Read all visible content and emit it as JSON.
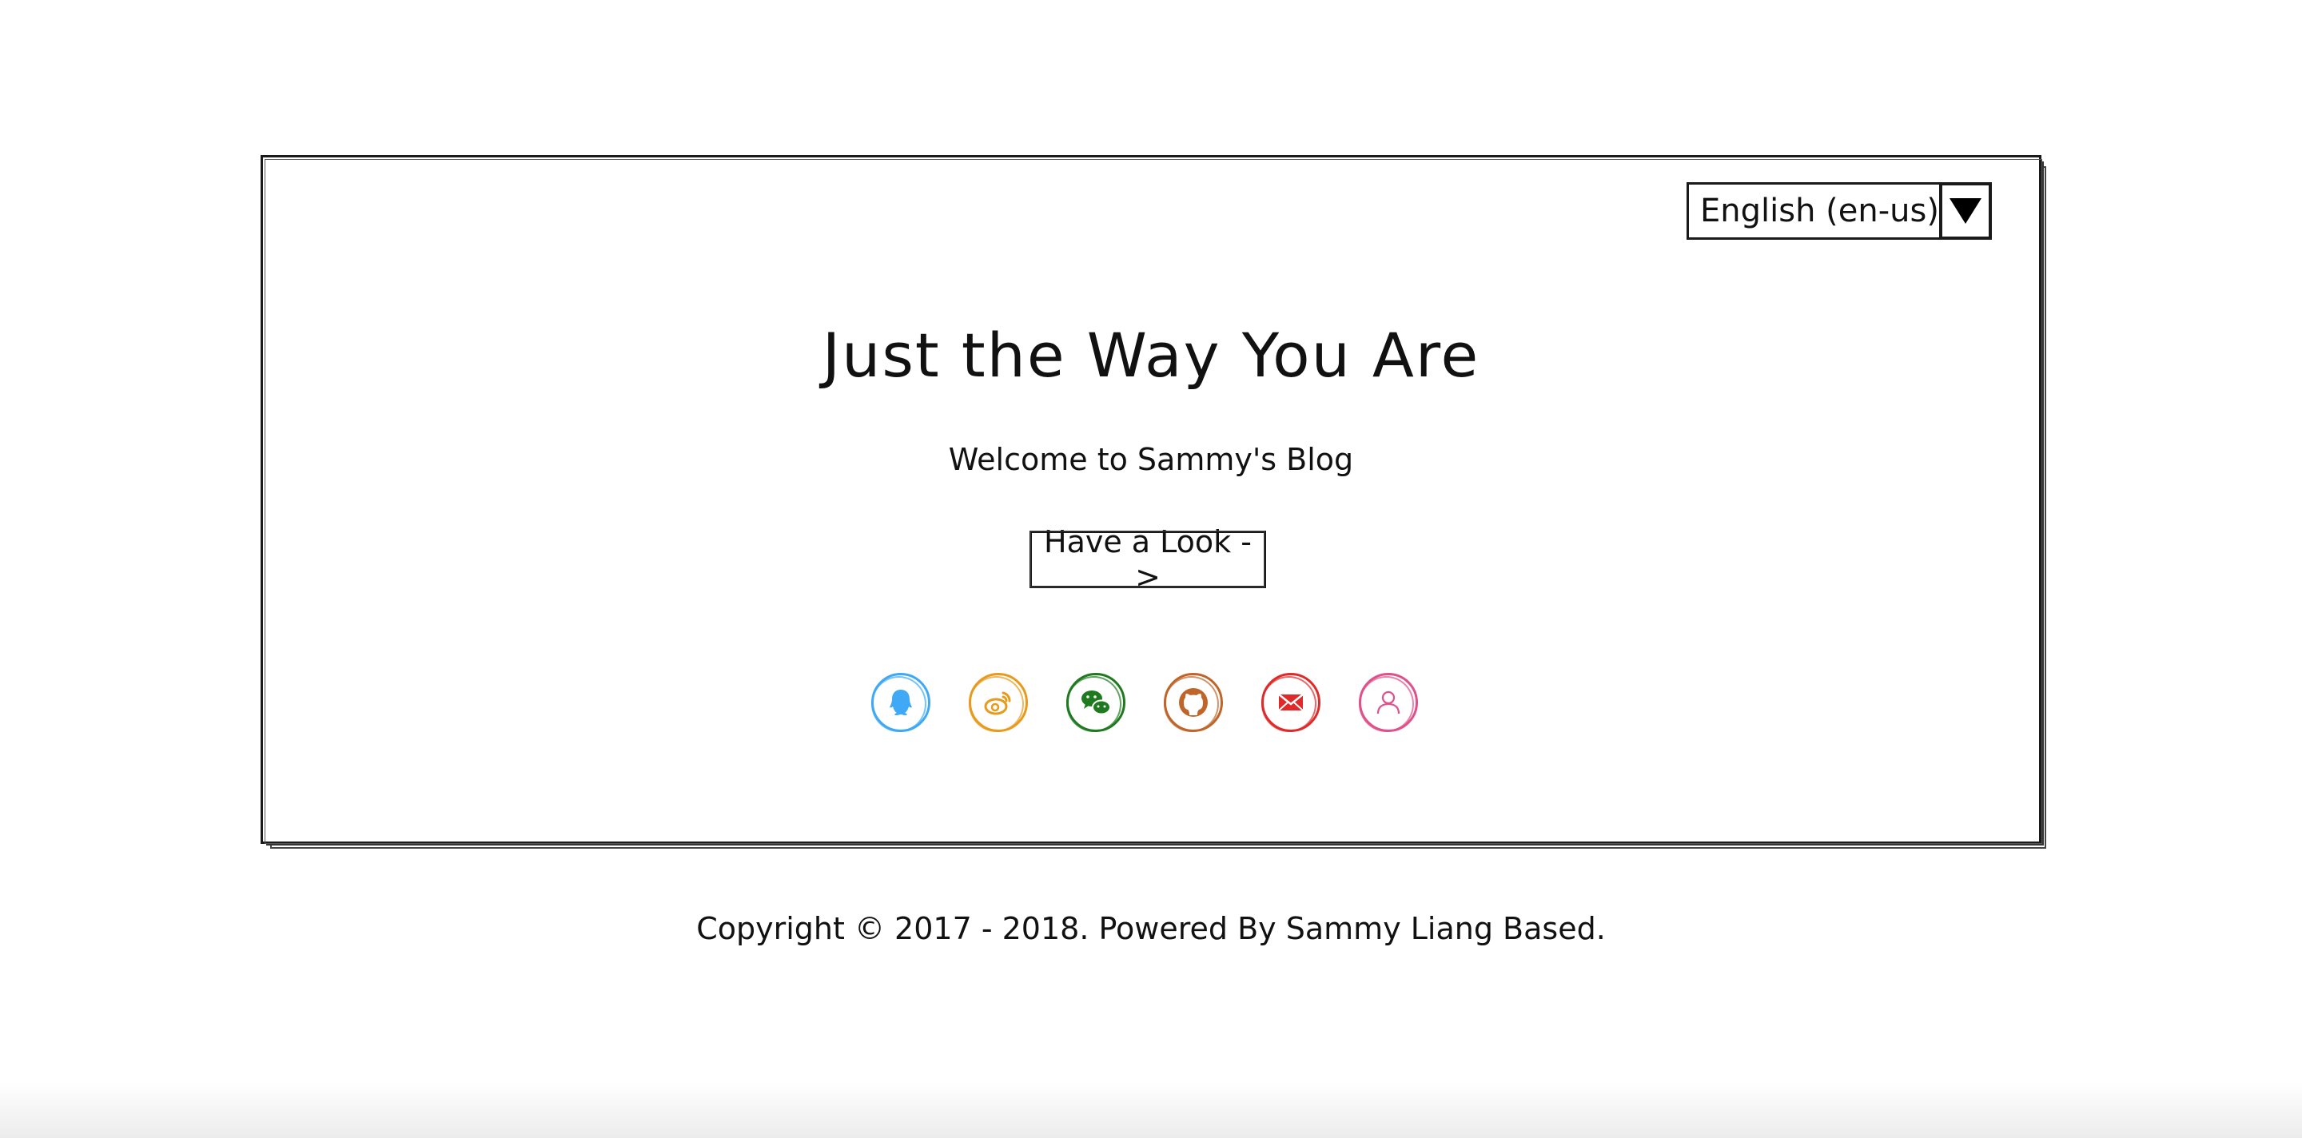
{
  "language_select": {
    "value": "English  (en-us)"
  },
  "hero": {
    "title": "Just the Way You Are",
    "subtitle": "Welcome to Sammy's Blog",
    "button_label": "Have a Look ->"
  },
  "social_links": [
    {
      "name": "qq-icon",
      "color": "#3fa9f5"
    },
    {
      "name": "weibo-icon",
      "color": "#e89a1c"
    },
    {
      "name": "wechat-icon",
      "color": "#1f7a1f"
    },
    {
      "name": "github-icon",
      "color": "#c0652a"
    },
    {
      "name": "email-icon",
      "color": "#e02a2a"
    },
    {
      "name": "user-icon",
      "color": "#e0508a"
    }
  ],
  "footer": {
    "copyright": "Copyright © 2017 - 2018. Powered By Sammy Liang Based."
  }
}
